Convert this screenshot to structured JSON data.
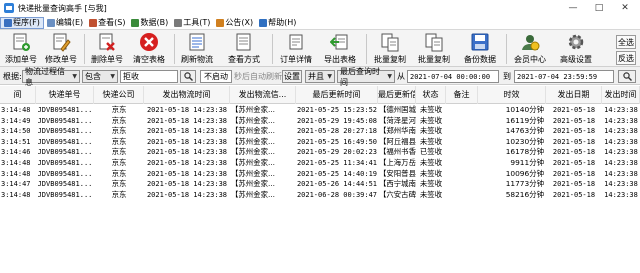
{
  "window": {
    "title": "快递批量查询高手 [与我]",
    "controls": [
      "—",
      "□",
      "✕"
    ]
  },
  "menu": {
    "items": [
      {
        "label": "程序(F)",
        "icon_color": "#3a70c0"
      },
      {
        "label": "编辑(E)",
        "icon_color": "#6a8fc2"
      },
      {
        "label": "查看(S)",
        "icon_color": "#c05030"
      },
      {
        "label": "数据(B)",
        "icon_color": "#3a8a3a"
      },
      {
        "label": "工具(T)",
        "icon_color": "#7a7a7a"
      },
      {
        "label": "公告(X)",
        "icon_color": "#d08020"
      },
      {
        "label": "帮助(H)",
        "icon_color": "#2f6fc0"
      }
    ]
  },
  "toolbar": {
    "buttons": [
      {
        "label": "添加单号",
        "icon": "add-document-icon"
      },
      {
        "label": "修改单号",
        "icon": "edit-document-icon"
      },
      {
        "label": "删除单号",
        "icon": "delete-document-icon"
      },
      {
        "label": "清空表格",
        "icon": "clear-table-icon"
      },
      {
        "label": "刷新物流",
        "icon": "refresh-logistics-icon"
      },
      {
        "label": "查看方式",
        "icon": "view-mode-icon"
      },
      {
        "label": "订单详情",
        "icon": "order-detail-icon"
      },
      {
        "label": "导出表格",
        "icon": "export-table-icon"
      },
      {
        "label": "批量复制",
        "icon": "batch-copy-icon"
      },
      {
        "label": "批量复制",
        "icon": "batch-copy-icon"
      },
      {
        "label": "备份数据",
        "icon": "backup-data-icon"
      },
      {
        "label": "会员中心",
        "icon": "member-center-icon"
      },
      {
        "label": "高级设置",
        "icon": "settings-icon"
      }
    ],
    "right_buttons": [
      "全选",
      "反选"
    ]
  },
  "filter": {
    "label": "根据:",
    "field_select": "物流过程信息",
    "mode_select": "包含",
    "keyword": "拒收",
    "search_icon": "search-icon",
    "auto_toggle": "不启动",
    "auto_hint": "秒后自动刷新",
    "settings_label": "设置",
    "logic_select": "并且",
    "time_field_select": "最后查询时间",
    "from_label": "从",
    "from_value": "2021-07-04 00:00:00",
    "to_label": "到",
    "to_value": "2021-07-04 23:59:59",
    "search_icon2": "search-icon"
  },
  "table": {
    "columns": [
      "间",
      "快递单号",
      "快递公司",
      "发出物流时间",
      "发出物流信...",
      "最后更新时间",
      "最后更新信息",
      "状态",
      "备注",
      "时效",
      "发出日期",
      "发出时间"
    ],
    "rows": [
      [
        "3:14:48",
        "JDVB095481...",
        "京东",
        "2021-05-18 14:23:38",
        "【苏州金家...",
        "2021-05-25 15:23:52",
        "【德州国城...",
        "未签收",
        "",
        "10140分钟",
        "2021-05-18",
        "14:23:38"
      ],
      [
        "3:14:49",
        "JDVB095481...",
        "京东",
        "2021-05-18 14:23:38",
        "【苏州金家...",
        "2021-05-29 19:45:08",
        "【菏泽星河...",
        "未签收",
        "",
        "16119分钟",
        "2021-05-18",
        "14:23:38"
      ],
      [
        "3:14:50",
        "JDVB095481...",
        "京东",
        "2021-05-18 14:23:38",
        "【苏州金家...",
        "2021-05-28 20:27:18",
        "【郑州华南...",
        "未签收",
        "",
        "14763分钟",
        "2021-05-18",
        "14:23:38"
      ],
      [
        "3:14:51",
        "JDVB095481...",
        "京东",
        "2021-05-18 14:23:38",
        "【苏州金家...",
        "2021-05-25 16:49:50",
        "【阿丘福县...",
        "未签收",
        "",
        "10230分钟",
        "2021-05-18",
        "14:23:38"
      ],
      [
        "3:14:46",
        "JDVB095481...",
        "京东",
        "2021-05-18 14:23:38",
        "【苏州金家...",
        "2021-05-29 20:02:23",
        "【福州书香...",
        "已签收",
        "",
        "16178分钟",
        "2021-05-18",
        "14:23:38"
      ],
      [
        "3:14:48",
        "JDVB095481...",
        "京东",
        "2021-05-18 14:23:38",
        "【苏州金家...",
        "2021-05-25 11:34:41",
        "【上海万岳...",
        "未签收",
        "",
        "9911分钟",
        "2021-05-18",
        "14:23:38"
      ],
      [
        "3:14:48",
        "JDVB095481...",
        "京东",
        "2021-05-18 14:23:38",
        "【苏州金家...",
        "2021-05-25 14:40:19",
        "【安阳普县...",
        "未签收",
        "",
        "10096分钟",
        "2021-05-18",
        "14:23:38"
      ],
      [
        "3:14:47",
        "JDVB095481...",
        "京东",
        "2021-05-18 14:23:38",
        "【苏州金家...",
        "2021-05-26 14:44:51",
        "【西宁城南...",
        "未签收",
        "",
        "11773分钟",
        "2021-05-18",
        "14:23:38"
      ],
      [
        "3:14:48",
        "JDVB095481...",
        "京东",
        "2021-05-18 14:23:38",
        "【苏州金家...",
        "2021-06-28 00:39:47",
        "【六安古碑...",
        "未签收",
        "",
        "58216分钟",
        "2021-05-18",
        "14:23:38"
      ]
    ]
  }
}
